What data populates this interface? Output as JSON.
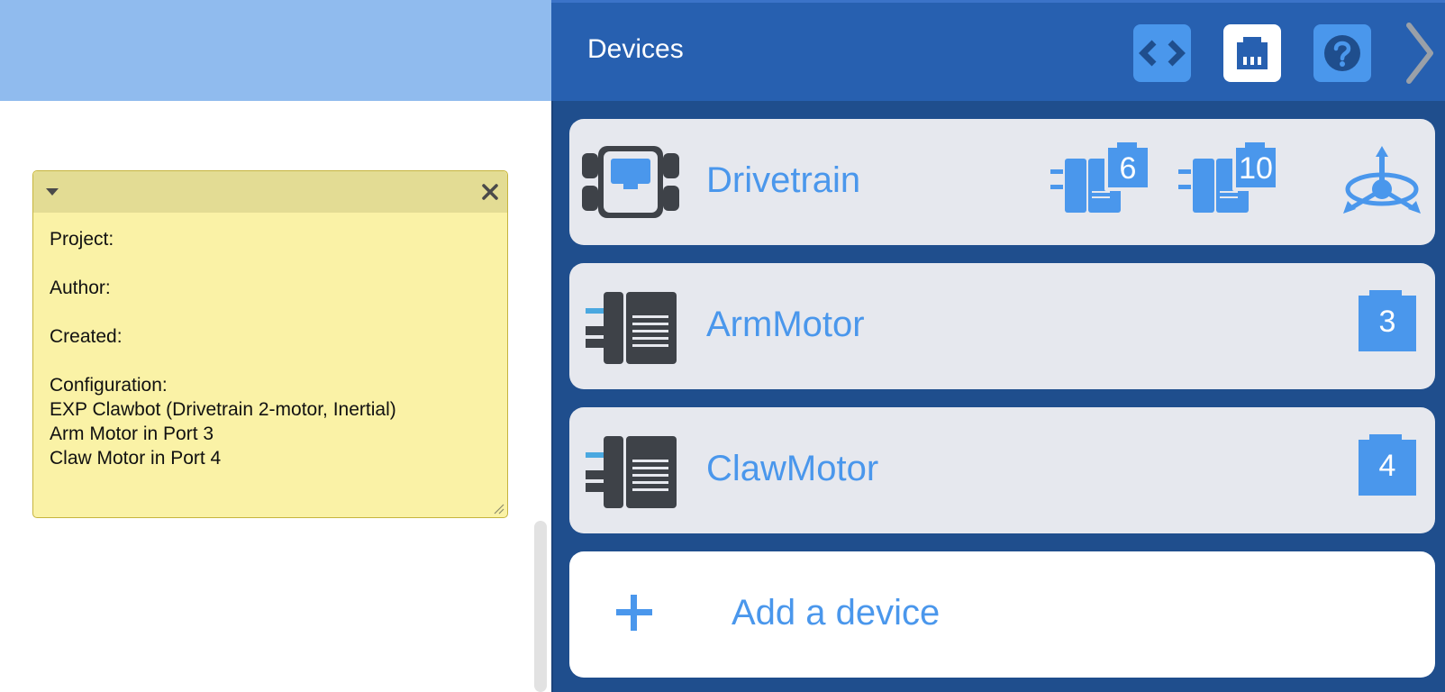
{
  "note": {
    "body": "Project:\n\nAuthor:\n\nCreated:\n\nConfiguration:\nEXP Clawbot (Drivetrain 2-motor, Inertial)\nArm Motor in Port 3\nClaw Motor in Port 4"
  },
  "panel": {
    "title": "Devices",
    "buttons": [
      {
        "name": "code-icon"
      },
      {
        "name": "devices-port-icon"
      },
      {
        "name": "help-icon"
      },
      {
        "name": "chevron-right-icon"
      }
    ]
  },
  "devices": [
    {
      "name": "Drivetrain",
      "icon": "drivetrain-icon",
      "ports": [
        "6",
        "10"
      ],
      "extra_icon": "inertial-sensor-icon"
    },
    {
      "name": "ArmMotor",
      "icon": "motor-icon",
      "ports": [
        "3"
      ]
    },
    {
      "name": "ClawMotor",
      "icon": "motor-icon",
      "ports": [
        "4"
      ]
    }
  ],
  "add_device": {
    "label": "Add a device",
    "icon": "plus-icon"
  },
  "colors": {
    "panel_bg": "#1f4e8d",
    "header_bg": "#2760b0",
    "accent": "#4a97ec",
    "card_bg": "#e6e8ee",
    "note_bg": "#faf2a6",
    "left_header_bg": "#90bbee"
  }
}
